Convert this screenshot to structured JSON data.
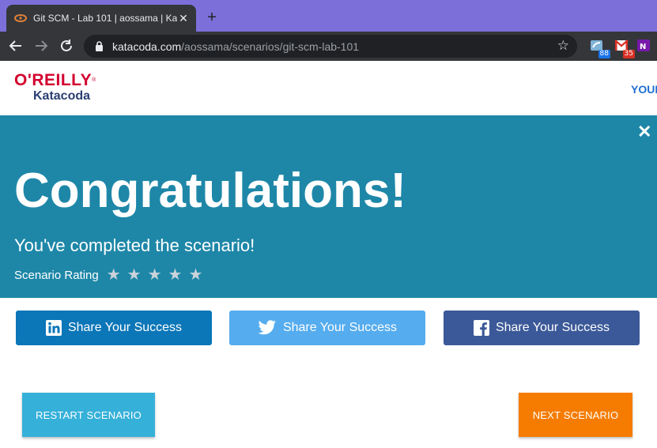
{
  "browser": {
    "tab_title": "Git SCM - Lab 101 | aossama | Ka",
    "tab_close": "✕",
    "new_tab": "+",
    "url_host": "katacoda.com",
    "url_path": "/aossama/scenarios/git-scm-lab-101",
    "extensions": [
      {
        "name": "extension-icon",
        "badge": "88",
        "badge_color": "#1a73e8"
      },
      {
        "name": "gmail-icon",
        "badge": "35",
        "badge_color": "#d93025"
      },
      {
        "name": "onenote-icon",
        "badge": "",
        "badge_color": ""
      }
    ]
  },
  "header": {
    "logo_oreilly": "O'REILLY",
    "logo_katacoda": "Katacoda",
    "nav_link": "YOUR"
  },
  "banner": {
    "close": "✕",
    "title": "Congratulations!",
    "subtitle": "You've completed the scenario!",
    "rating_label": "Scenario Rating",
    "stars": 5,
    "background": "#1e87a8"
  },
  "share": {
    "linkedin_label": "Share Your Success",
    "twitter_label": "Share Your Success",
    "facebook_label": "Share Your Success",
    "colors": {
      "linkedin": "#0b76b8",
      "twitter": "#55acee",
      "facebook": "#3b5998"
    }
  },
  "actions": {
    "restart_label": "RESTART SCENARIO",
    "next_label": "NEXT SCENARIO",
    "colors": {
      "restart": "#35b0d9",
      "next": "#f57c00"
    }
  }
}
